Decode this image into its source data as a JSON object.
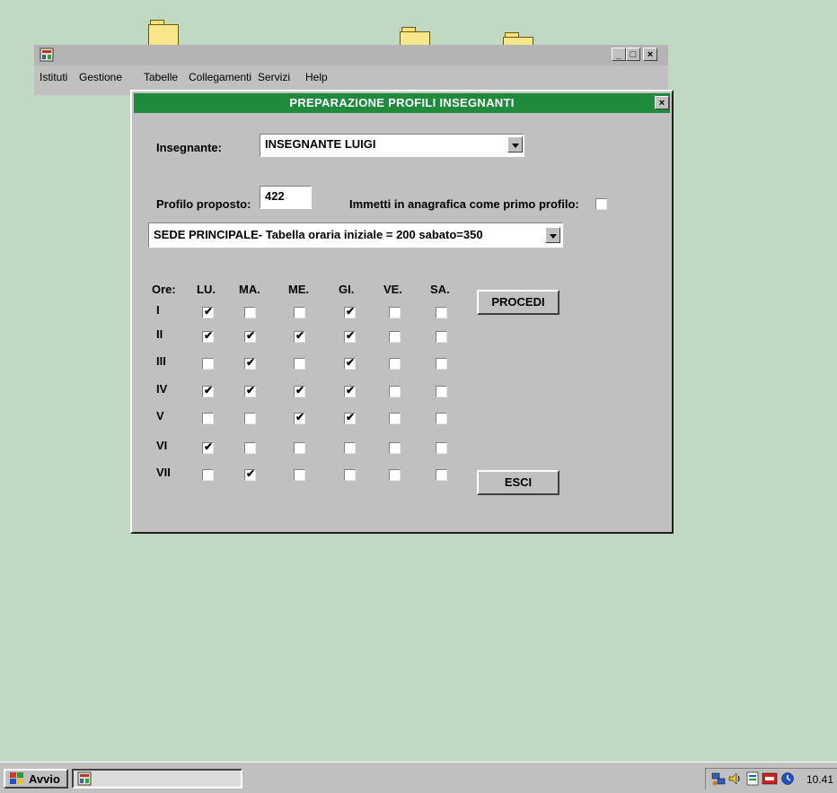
{
  "app": {
    "menu": [
      "Istituti",
      "Gestione",
      "Tabelle",
      "Collegamenti",
      "Servizi",
      "Help"
    ],
    "controls": {
      "minimize": "_",
      "maximize": "□",
      "close": "×"
    }
  },
  "dialog": {
    "title": "PREPARAZIONE PROFILI INSEGNANTI",
    "close_label": "×",
    "teacher_label": "Insegnante:",
    "teacher_value": "INSEGNANTE LUIGI",
    "profile_label": "Profilo proposto:",
    "profile_value": "422",
    "first_profile_label": "Immetti in anagrafica come primo profilo:",
    "first_profile_checked": false,
    "schedule_value": "SEDE PRINCIPALE- Tabella oraria iniziale = 200 sabato=350",
    "grid": {
      "ore_label": "Ore:",
      "days": [
        "LU.",
        "MA.",
        "ME.",
        "GI.",
        "VE.",
        "SA."
      ],
      "rows": [
        {
          "hour": "I",
          "checks": [
            true,
            false,
            false,
            true,
            false,
            false
          ]
        },
        {
          "hour": "II",
          "checks": [
            true,
            true,
            true,
            true,
            false,
            false
          ]
        },
        {
          "hour": "III",
          "checks": [
            false,
            true,
            false,
            true,
            false,
            false
          ]
        },
        {
          "hour": "IV",
          "checks": [
            true,
            true,
            true,
            true,
            false,
            false
          ]
        },
        {
          "hour": "V",
          "checks": [
            false,
            false,
            true,
            true,
            false,
            false
          ]
        },
        {
          "hour": "VI",
          "checks": [
            true,
            false,
            false,
            false,
            false,
            false
          ]
        },
        {
          "hour": "VII",
          "checks": [
            false,
            true,
            false,
            false,
            false,
            false
          ]
        }
      ]
    },
    "procedi_label": "PROCEDI",
    "esci_label": "ESCI"
  },
  "taskbar": {
    "start_label": "Avvio",
    "clock": "10.41"
  }
}
